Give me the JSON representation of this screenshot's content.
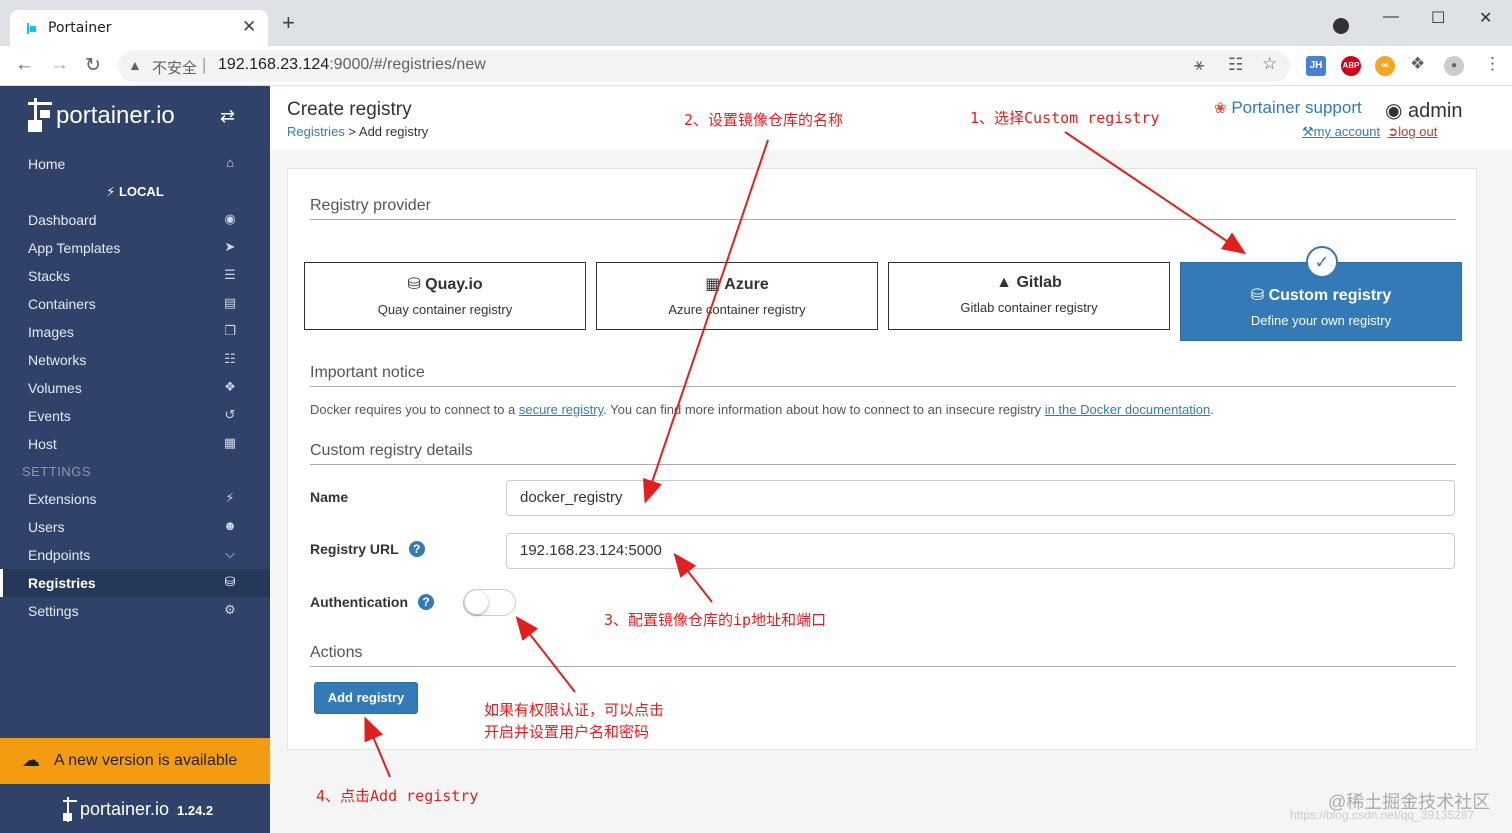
{
  "browser": {
    "tab_title": "Portainer",
    "tab_close": "✕",
    "new_tab": "+",
    "insecure_label": "不安全",
    "url_host": "192.168.23.124",
    "url_rest": ":9000/#/registries/new",
    "ext_jh": "JH",
    "ext_abp": "ABP"
  },
  "sidebar": {
    "logo_text": "portainer.io",
    "endpoint": "LOCAL",
    "items": [
      {
        "label": "Home",
        "icon": "home-icon"
      },
      {
        "label": "Dashboard",
        "icon": "tachometer-icon"
      },
      {
        "label": "App Templates",
        "icon": "rocket-icon"
      },
      {
        "label": "Stacks",
        "icon": "th-list-icon"
      },
      {
        "label": "Containers",
        "icon": "server-icon"
      },
      {
        "label": "Images",
        "icon": "clone-icon"
      },
      {
        "label": "Networks",
        "icon": "sitemap-icon"
      },
      {
        "label": "Volumes",
        "icon": "cubes-icon"
      },
      {
        "label": "Events",
        "icon": "history-icon"
      },
      {
        "label": "Host",
        "icon": "th-icon"
      }
    ],
    "settings_header": "SETTINGS",
    "settings_items": [
      {
        "label": "Extensions",
        "icon": "bolt-icon"
      },
      {
        "label": "Users",
        "icon": "users-icon"
      },
      {
        "label": "Endpoints",
        "icon": "plug-icon"
      },
      {
        "label": "Registries",
        "icon": "database-icon",
        "active": true
      },
      {
        "label": "Settings",
        "icon": "cogs-icon"
      }
    ],
    "new_version": "A new version is available",
    "footer_logo": "portainer.io",
    "version": "1.24.2"
  },
  "header": {
    "title": "Create registry",
    "breadcrumb_link": "Registries",
    "breadcrumb_current": "> Add registry",
    "support": "Portainer support",
    "user": "admin",
    "my_account": "my account",
    "log_out": "log out"
  },
  "form": {
    "section_provider": "Registry provider",
    "providers": [
      {
        "title": "Quay.io",
        "desc": "Quay container registry"
      },
      {
        "title": "Azure",
        "desc": "Azure container registry"
      },
      {
        "title": "Gitlab",
        "desc": "Gitlab container registry"
      },
      {
        "title": "Custom registry",
        "desc": "Define your own registry",
        "selected": true
      }
    ],
    "section_notice": "Important notice",
    "notice_pre": "Docker requires you to connect to a ",
    "notice_link1": "secure registry",
    "notice_mid": ". You can find more information about how to connect to an insecure registry ",
    "notice_link2": "in the Docker documentation",
    "notice_post": ".",
    "section_details": "Custom registry details",
    "name_label": "Name",
    "name_value": "docker_registry",
    "url_label": "Registry URL",
    "url_value": "192.168.23.124:5000",
    "auth_label": "Authentication",
    "auth_enabled": false,
    "section_actions": "Actions",
    "add_button": "Add registry"
  },
  "annotations": {
    "a1": "1、选择Custom registry",
    "a2": "2、设置镜像仓库的名称",
    "a3": "3、配置镜像仓库的ip地址和端口",
    "a4": "4、点击Add registry",
    "a5_line1": "如果有权限认证，可以点击",
    "a5_line2": "开启并设置用户名和密码"
  },
  "watermark": "@稀土掘金技术社区",
  "watermark_faint": "https://blog.csdn.net/qq_39135287",
  "colors": {
    "sidebar": "#30426a",
    "accent": "#337ab7",
    "notify": "#f39c12",
    "annotation": "#e02020"
  }
}
